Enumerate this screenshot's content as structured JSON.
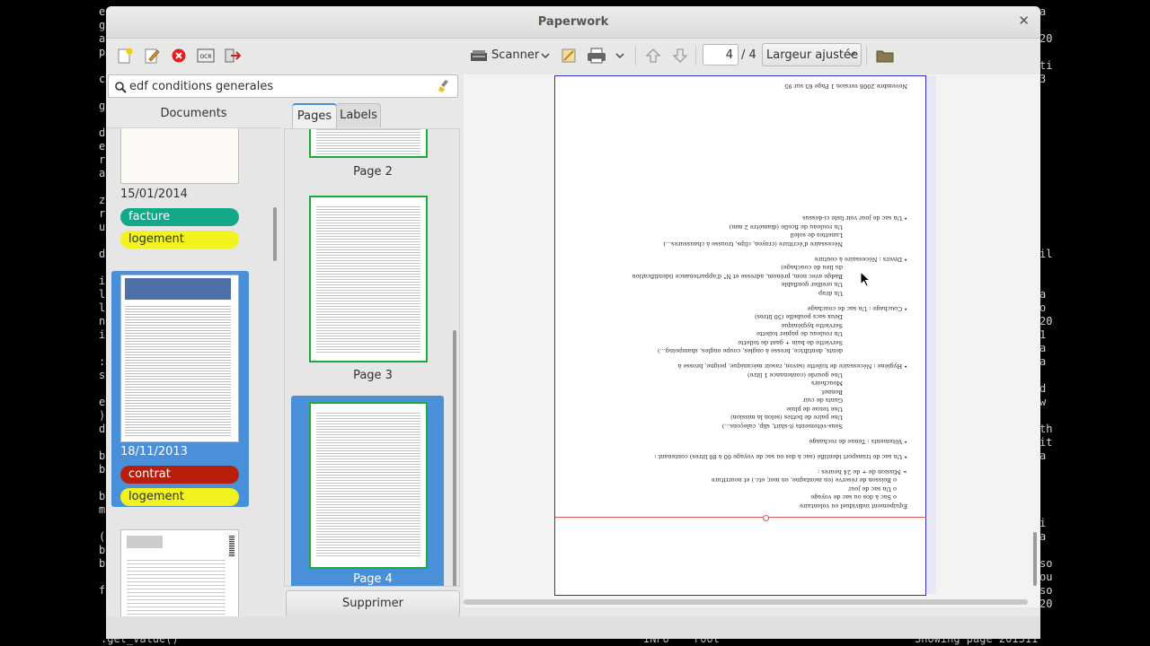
{
  "terminal": {
    "left_chars": "e\ng\na\np\n\nc\n\ng\n\nd\ne\nr\na\n\nz\nr\nu\n\nd\n\ni\nl\nl\nn\ni\n\n:\ns\n\ne\n)\nd\n\nb\nb\n\nb\nm\n\n(\nb\nb\n\nf\n",
    "right_chars": "a\n\n20\n\nti\n3\n\n\n\n\n\n\n\n\n\n\n\n\nil\n\n\na\no\n20\n1\na\na\n\nd\nw\n\nth\nit\na\n\n\n\n\ni\na\n\nso\nou\nso\n20",
    "bottom_left": ".get_value()",
    "bottom_mid1": "INFO",
    "bottom_mid2": "root",
    "bottom_right": "Showing page 201311"
  },
  "window": {
    "title": "Paperwork"
  },
  "toolbar": {
    "scanner_label": "Scanner",
    "page_current": "4",
    "page_total": "/ 4",
    "zoom_value": "Largeur ajustée"
  },
  "search": {
    "query": "edf conditions generales"
  },
  "documents": {
    "header": "Documents",
    "items": [
      {
        "date": "15/01/2014",
        "labels": [
          {
            "name": "facture",
            "color": "#13a988",
            "text_color": "#ffffff"
          },
          {
            "name": "logement",
            "color": "#f2f21e",
            "text_color": "#2e3436"
          }
        ]
      },
      {
        "date": "18/11/2013",
        "labels": [
          {
            "name": "contrat",
            "color": "#b81e0c",
            "text_color": "#ffffff"
          },
          {
            "name": "logement",
            "color": "#f2f21e",
            "text_color": "#2e3436"
          }
        ],
        "selected": true
      }
    ]
  },
  "tabs": {
    "pages": "Pages",
    "labels": "Labels"
  },
  "pages": [
    {
      "label": "Page 2"
    },
    {
      "label": "Page 3"
    },
    {
      "label": "Page 4",
      "selected": true
    }
  ],
  "delete_button": "Supprimer",
  "doc_page": {
    "lines": [
      "Équipement individuel ou volontaire",
      "o  Sac à dos ou sac de voyage",
      "o  Un sac de jour",
      "o  Boisson de réserve (en montagne, en mer, etc.) et nourriture",
      "➢ Mission de + de 24 heures :",
      "•  Un sac de transport identifié (sac à dos ou sac de voyage 60 à 80 litres) contenant :",
      "•  Vêtements :  Tenue de rechange",
      "   Sous-vêtements (t-shirt, slip, caleçons...)",
      "   Une paire de bottes (selon la mission)",
      "   Une tenue de pluie",
      "   Gants de cuir",
      "   Bonnet",
      "   Mouchoirs",
      "   Une gourde (contenance 1 litre)",
      "•  Hygiène :  Nécessaire de toilette (savon, rasoir mécanique, peigne, brosse à",
      "   dents, dentifrice, brosse à ongles, coupe ongles, shampoing...)",
      "   Serviette de bain + gant de toilette",
      "   Un rouleau de papier toilette",
      "   Serviette hygiénique",
      "   Deux sacs poubelle (50 litres)",
      "•  Couchage :  Un sac de couchage",
      "   Un drap",
      "   Un oreiller gonflable",
      "   Badge avec nom, prénom, adresse et N° d'appartenance (identification",
      "   du lieu de couchage)",
      "•  Divers :  Nécessaire à couture",
      "   Nécessaire d'écriture (crayon, clips, trousse à chaussures...)",
      "   Lunettes de soleil",
      "   Un rouleau de ficelle (diamètre 2 mm)",
      "•  Un sac de jour  voir liste ci-dessus",
      "Novembre 2008    version 1    Page 65 sur 95"
    ]
  }
}
